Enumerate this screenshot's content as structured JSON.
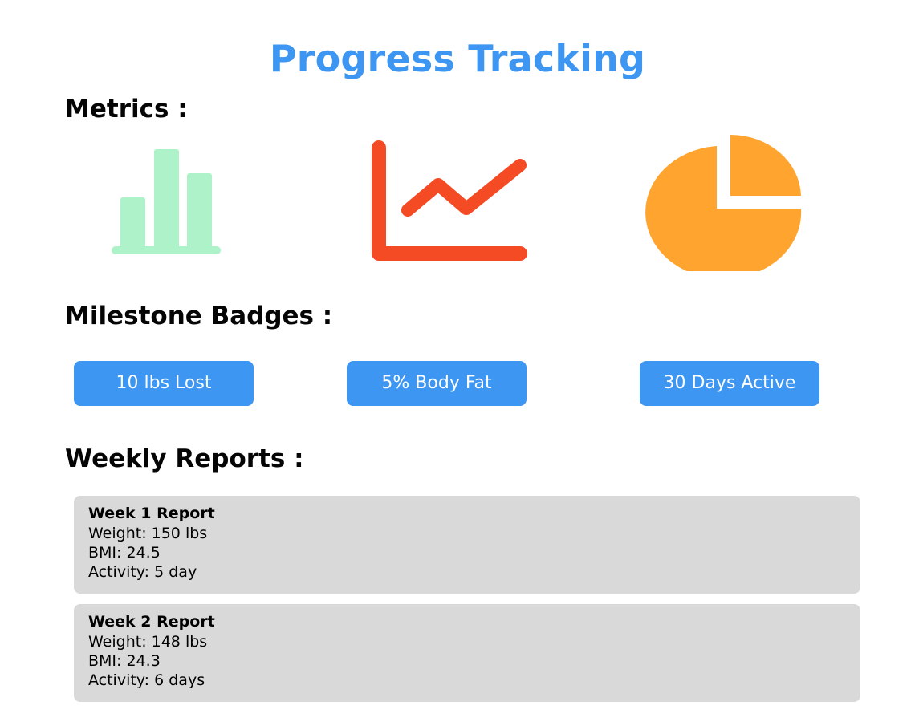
{
  "page": {
    "title": "Progress Tracking"
  },
  "colors": {
    "accent_blue": "#3d96f1",
    "bar_chart_green": "#aef2c9",
    "line_chart_red": "#f54b25",
    "pie_chart_orange": "#ffa42f",
    "card_gray": "#d9d9d9"
  },
  "metrics": {
    "heading": "Metrics :",
    "icons": [
      {
        "name": "bar-chart-icon"
      },
      {
        "name": "line-chart-icon"
      },
      {
        "name": "pie-chart-icon"
      }
    ]
  },
  "badges": {
    "heading": "Milestone Badges :",
    "items": [
      {
        "label": "10 lbs Lost"
      },
      {
        "label": "5% Body Fat"
      },
      {
        "label": "30 Days Active"
      }
    ]
  },
  "reports": {
    "heading": "Weekly Reports :",
    "items": [
      {
        "title": "Week 1 Report",
        "weight": "Weight: 150 lbs",
        "bmi": "BMI: 24.5",
        "activity": "Activity: 5 day"
      },
      {
        "title": "Week 2 Report",
        "weight": "Weight: 148 lbs",
        "bmi": "BMI: 24.3",
        "activity": "Activity: 6 days"
      }
    ]
  }
}
